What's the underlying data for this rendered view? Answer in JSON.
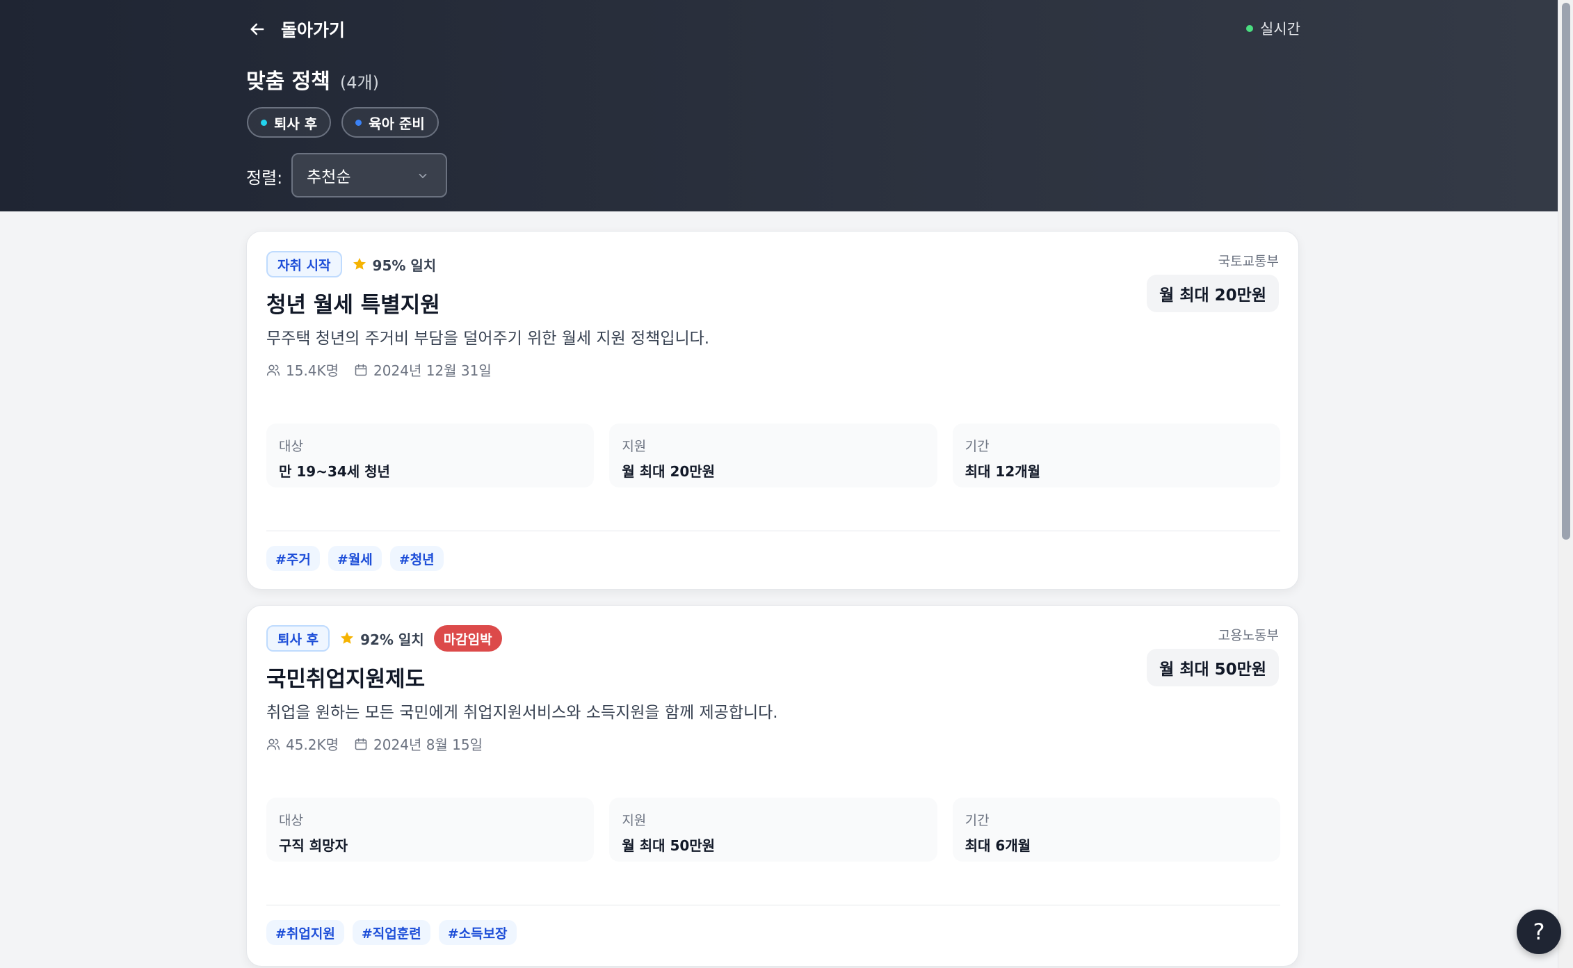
{
  "header": {
    "back_label": "돌아가기",
    "live_label": "실시간",
    "title": "맞춤 정책",
    "count": "(4개)",
    "filters": [
      {
        "label": "퇴사 후",
        "dot_color": "#22d3ee"
      },
      {
        "label": "육아 준비",
        "dot_color": "#3b82f6"
      }
    ],
    "sort_label": "정렬:",
    "sort_value": "추천순"
  },
  "policies": [
    {
      "category": "자취 시작",
      "match": "95% 일치",
      "urgent": "",
      "title": "청년 월세 특별지원",
      "description": "무주택 청년의 주거비 부담을 덜어주기 위한 월세 지원 정책입니다.",
      "participants": "15.4K명",
      "deadline": "2024년 12월 31일",
      "ministry": "국토교통부",
      "amount": "월 최대 20만원",
      "info": [
        {
          "label": "대상",
          "value": "만 19~34세 청년"
        },
        {
          "label": "지원",
          "value": "월 최대 20만원"
        },
        {
          "label": "기간",
          "value": "최대 12개월"
        }
      ],
      "tags": [
        "#주거",
        "#월세",
        "#청년"
      ]
    },
    {
      "category": "퇴사 후",
      "match": "92% 일치",
      "urgent": "마감임박",
      "title": "국민취업지원제도",
      "description": "취업을 원하는 모든 국민에게 취업지원서비스와 소득지원을 함께 제공합니다.",
      "participants": "45.2K명",
      "deadline": "2024년 8월 15일",
      "ministry": "고용노동부",
      "amount": "월 최대 50만원",
      "info": [
        {
          "label": "대상",
          "value": "구직 희망자"
        },
        {
          "label": "지원",
          "value": "월 최대 50만원"
        },
        {
          "label": "기간",
          "value": "최대 6개월"
        }
      ],
      "tags": [
        "#취업지원",
        "#직업훈련",
        "#소득보장"
      ]
    }
  ],
  "help_label": "?",
  "colors": {
    "header_bg": "#1f2533",
    "accent_blue": "#1d4ed8",
    "live_green": "#4ade80",
    "urgent_red": "#dc4a4a",
    "star_yellow": "#f5b301"
  }
}
